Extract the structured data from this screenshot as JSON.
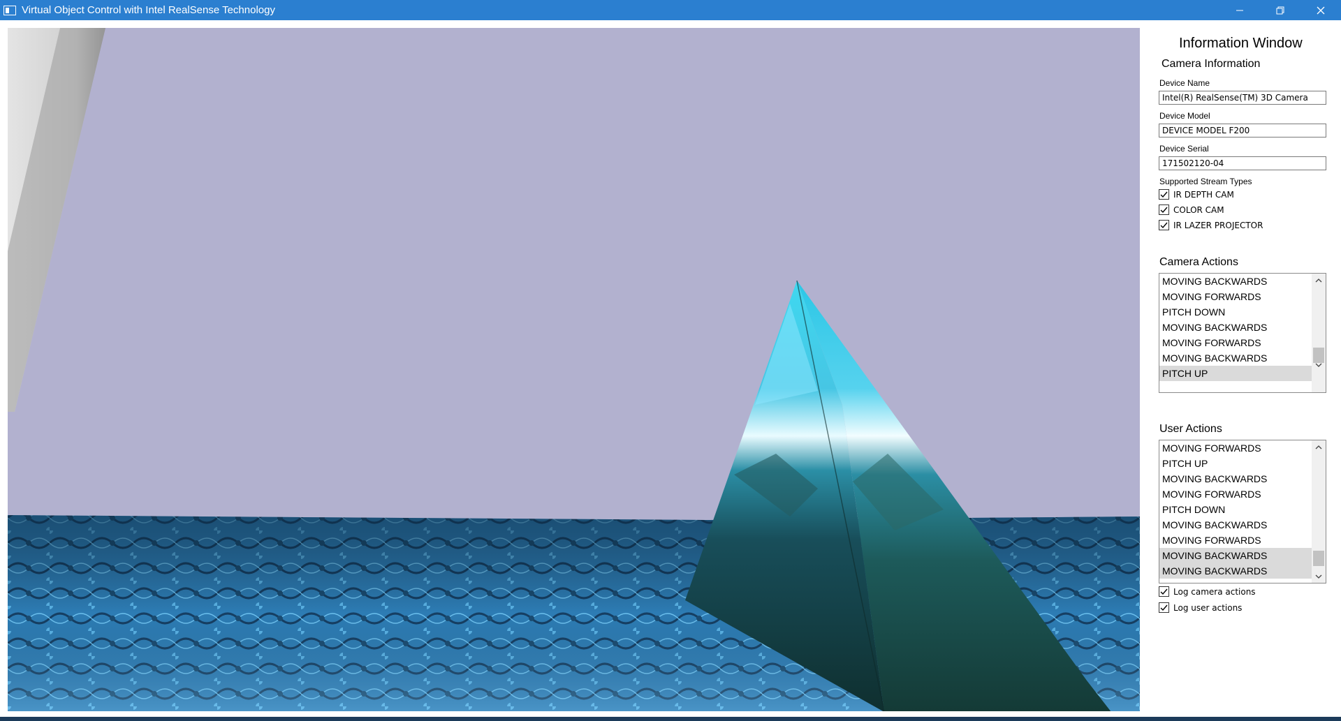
{
  "window": {
    "title": "Virtual Object Control with Intel RealSense Technology"
  },
  "panel": {
    "title": "Information Window",
    "camera_info": {
      "heading": "Camera Information",
      "device_name_label": "Device Name",
      "device_name_value": "Intel(R) RealSense(TM) 3D Camera",
      "device_model_label": "Device Model",
      "device_model_value": "DEVICE MODEL F200",
      "device_serial_label": "Device Serial",
      "device_serial_value": "171502120-04",
      "stream_types_label": "Supported Stream Types",
      "stream_types": [
        {
          "label": "IR DEPTH CAM",
          "checked": true
        },
        {
          "label": "COLOR CAM",
          "checked": true
        },
        {
          "label": "IR LAZER PROJECTOR",
          "checked": true
        }
      ]
    },
    "camera_actions": {
      "heading": "Camera Actions",
      "items": [
        "MOVING BACKWARDS",
        "MOVING FORWARDS",
        "PITCH DOWN",
        "MOVING BACKWARDS",
        "MOVING FORWARDS",
        "MOVING BACKWARDS",
        "PITCH UP"
      ],
      "selected_index": 6
    },
    "user_actions": {
      "heading": "User Actions",
      "items": [
        "MOVING FORWARDS",
        "PITCH UP",
        "MOVING BACKWARDS",
        "MOVING FORWARDS",
        "PITCH DOWN",
        "MOVING BACKWARDS",
        "MOVING FORWARDS",
        "MOVING BACKWARDS",
        "MOVING BACKWARDS"
      ],
      "selected_indices": [
        7,
        8
      ]
    },
    "options": {
      "log_camera_label": "Log camera actions",
      "log_camera_checked": true,
      "log_user_label": "Log user actions",
      "log_user_checked": true
    }
  },
  "colors": {
    "titlebar": "#2b7fd0",
    "sky": "#b2b1cf",
    "floor": "#2f7fb8",
    "selection": "#dadada"
  }
}
